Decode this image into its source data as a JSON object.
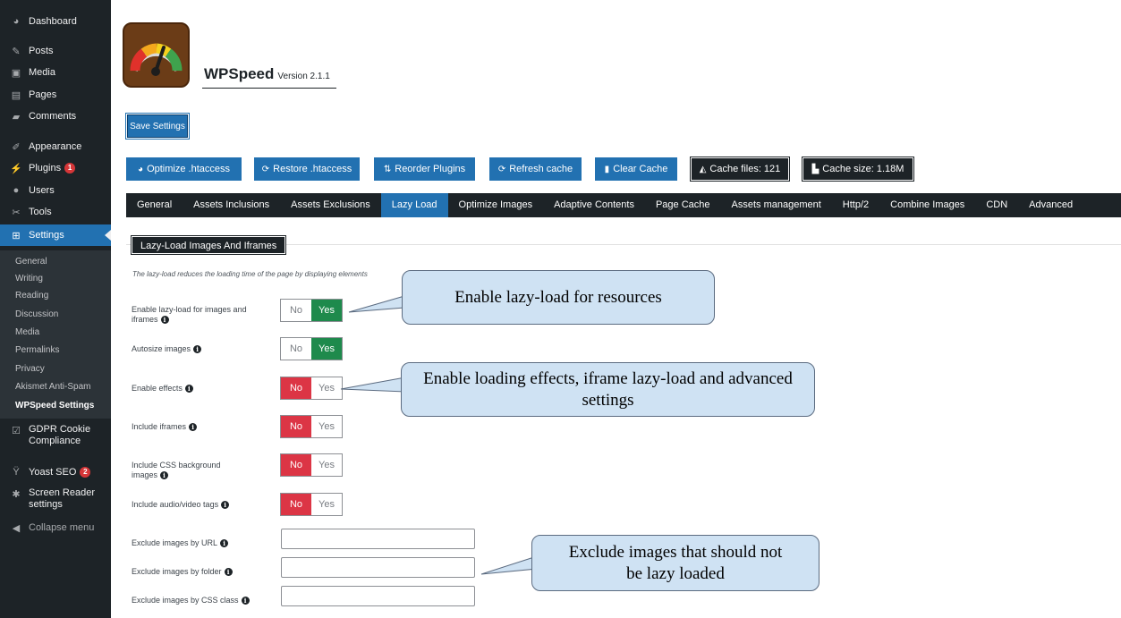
{
  "sidebar": {
    "items": [
      {
        "label": "Dashboard",
        "icon": "dashboard-icon"
      },
      {
        "label": "Posts",
        "icon": "pin-icon"
      },
      {
        "label": "Media",
        "icon": "media-icon"
      },
      {
        "label": "Pages",
        "icon": "pages-icon"
      },
      {
        "label": "Comments",
        "icon": "comment-icon"
      },
      {
        "label": "Appearance",
        "icon": "brush-icon"
      },
      {
        "label": "Plugins",
        "icon": "plugin-icon",
        "badge": "1"
      },
      {
        "label": "Users",
        "icon": "users-icon"
      },
      {
        "label": "Tools",
        "icon": "wrench-icon"
      },
      {
        "label": "Settings",
        "icon": "settings-icon"
      },
      {
        "label": "GDPR Cookie Compliance",
        "icon": "checkbox-icon"
      },
      {
        "label": "Yoast SEO",
        "icon": "yoast-icon",
        "badge": "2"
      },
      {
        "label": "Screen Reader settings",
        "icon": "gear-icon"
      },
      {
        "label": "Collapse menu",
        "icon": "collapse-icon"
      }
    ],
    "submenu": [
      "General",
      "Writing",
      "Reading",
      "Discussion",
      "Media",
      "Permalinks",
      "Privacy",
      "Akismet Anti-Spam",
      "WPSpeed Settings"
    ]
  },
  "header": {
    "title": "WPSpeed",
    "version": "Version 2.1.1",
    "save_label": "Save Settings"
  },
  "actions": [
    {
      "label": "Optimize .htaccess",
      "icon": "dashboard-icon"
    },
    {
      "label": "Restore .htaccess",
      "icon": "refresh-icon"
    },
    {
      "label": "Reorder Plugins",
      "icon": "sort-icon"
    },
    {
      "label": "Refresh cache",
      "icon": "refresh-icon"
    },
    {
      "label": "Clear Cache",
      "icon": "trash-icon"
    },
    {
      "label": "Cache files: 121",
      "icon": "chart-area-icon"
    },
    {
      "label": "Cache size: 1.18M",
      "icon": "chart-bar-icon"
    }
  ],
  "tabs": [
    "General",
    "Assets Inclusions",
    "Assets Exclusions",
    "Lazy Load",
    "Optimize Images",
    "Adaptive Contents",
    "Page Cache",
    "Assets management",
    "Http/2",
    "Combine Images",
    "CDN",
    "Advanced"
  ],
  "panel": {
    "title": "Lazy-Load Images And Iframes",
    "description": "The lazy-load reduces the loading time of the page by displaying elements",
    "settings": [
      {
        "label": "Enable lazy-load for images and iframes",
        "no": "No",
        "yes": "Yes",
        "value": "Yes"
      },
      {
        "label": "Autosize images",
        "no": "No",
        "yes": "Yes",
        "value": "Yes"
      },
      {
        "label": "Enable effects",
        "no": "No",
        "yes": "Yes",
        "value": "No"
      },
      {
        "label": "Include iframes",
        "no": "No",
        "yes": "Yes",
        "value": "No"
      },
      {
        "label": "Include CSS background images",
        "no": "No",
        "yes": "Yes",
        "value": "No"
      },
      {
        "label": "Include audio/video tags",
        "no": "No",
        "yes": "Yes",
        "value": "No"
      }
    ],
    "inputs": [
      {
        "label": "Exclude images by URL",
        "value": ""
      },
      {
        "label": "Exclude images by folder",
        "value": ""
      },
      {
        "label": "Exclude images by CSS class",
        "value": ""
      }
    ]
  },
  "callouts": [
    "Enable lazy-load for resources",
    "Enable loading effects, iframe lazy-load and advanced settings",
    "Exclude  images that should not be lazy loaded"
  ],
  "colors": {
    "sidebar_bg": "#1d2327",
    "accent": "#2271b1",
    "toggle_on": "#1e8a4c",
    "toggle_off": "#dc3545",
    "callout_bg": "#cfe2f3"
  }
}
